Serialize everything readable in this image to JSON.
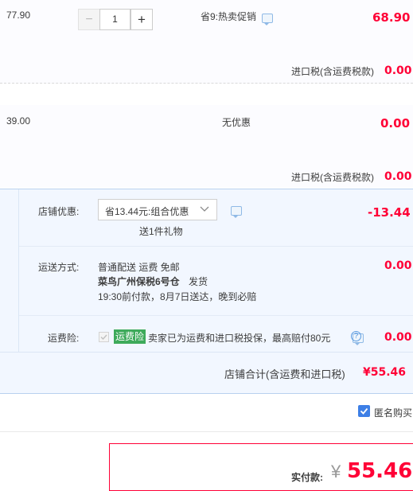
{
  "item1": {
    "price": "77.90",
    "qty": "1",
    "minus": "−",
    "plus": "+",
    "promo": "省9:热卖促销",
    "total": "68.90",
    "tax_label": "进口税(含运费税款)",
    "tax_value": "0.00"
  },
  "item2": {
    "price": "39.00",
    "promo": "无优惠",
    "total": "0.00",
    "tax_label": "进口税(含运费税款)",
    "tax_value": "0.00"
  },
  "shop": {
    "discount_label": "店铺优惠:",
    "discount_select": "省13.44元:组合优惠",
    "gift": "送1件礼物",
    "discount_value": "-13.44",
    "delivery_label": "运送方式:",
    "delivery_line1": "普通配送 运费 免邮",
    "delivery_line2": "菜鸟广州保税6号仓",
    "delivery_ship": "发货",
    "delivery_line3": "19:30前付款，8月7日送达，晚到必赔",
    "delivery_value": "0.00",
    "insurance_label": "运费险:",
    "insurance_tag": "运费险",
    "insurance_text": "卖家已为运费和进口税投保，最高赔付80元",
    "insurance_value": "0.00",
    "subtotal_label": "店铺合计(含运费和进口税)",
    "subtotal_value": "¥55.46"
  },
  "anonymous": {
    "label": "匿名购买",
    "checked": true
  },
  "pay": {
    "label": "实付款:",
    "currency": "¥",
    "amount": "55.46"
  },
  "colors": {
    "accent_red": "#ff0036",
    "shop_bg": "#f2f7ff",
    "item_bg": "#fcfcff",
    "checkbox_blue": "#3d7fe6",
    "insurance_green": "#3eaa5b"
  }
}
